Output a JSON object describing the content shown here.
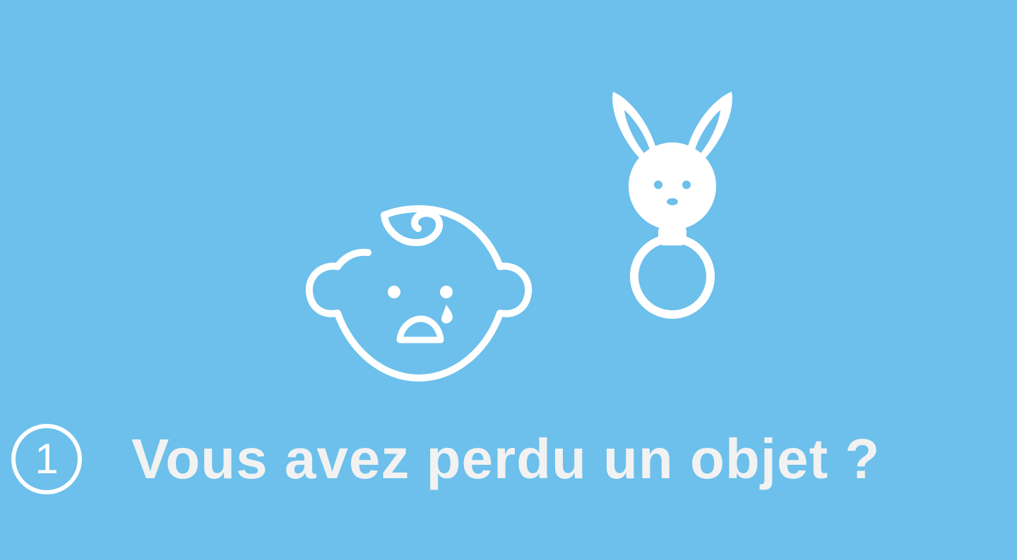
{
  "colors": {
    "background": "#6cc0eb",
    "icon": "#ffffff",
    "text": "#f2f2f2"
  },
  "icons": {
    "baby": "crying-baby-face-icon",
    "rattle": "bunny-rattle-icon"
  },
  "step": {
    "number": "1",
    "title": "Vous avez perdu un objet ?"
  }
}
